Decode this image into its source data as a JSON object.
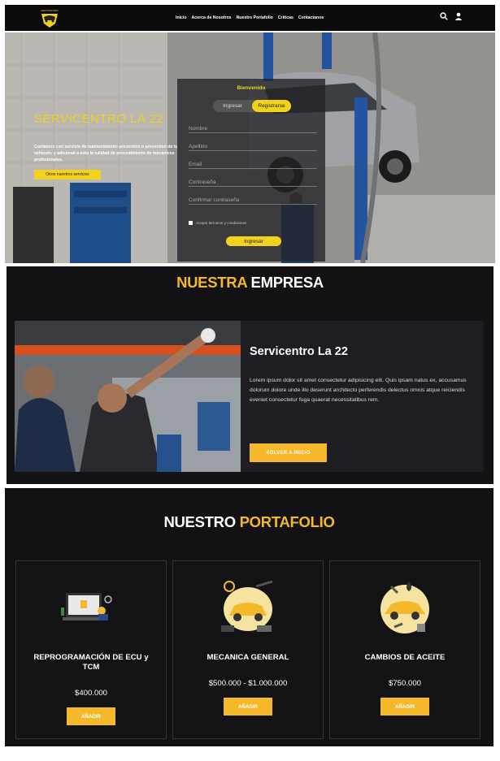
{
  "nav": {
    "logo_text": "SERVICENTRO",
    "menu": [
      "Inicio",
      "Acerca de Nosotros",
      "Nuestro Portafolio",
      "Críticas",
      "Contactanos"
    ],
    "icons": [
      "search-icon",
      "user-icon"
    ]
  },
  "hero": {
    "title": "SERVICENTRO LA 22",
    "text": "Contamos con servicio de mantenimiento preventivo o preventivo de tu vehículo, y adicional a esto la calidad de procedimiento de mecánicos profesionales.",
    "button": "Otros nuestros servicios"
  },
  "login": {
    "welcome": "Bienvenido",
    "tab_login": "Ingresar",
    "tab_register": "Registrarse",
    "fields": [
      "Nombre",
      "Apellido",
      "Email",
      "Contraseña",
      "Confirmar contraseña"
    ],
    "remember": "Acepto terminos y condiciones",
    "submit": "Ingresar"
  },
  "empresa": {
    "title_a": "NUESTRA",
    "title_b": "EMPRESA",
    "name": "Servicentro La 22",
    "text": "Lorem ipsum dolor sit amet consectetur adipisicing elit. Quis ipsam natus ex, accusamus dolorum dolore unde illo deserunt architecto perferendis delectus omnis atque reiciendis eveniet consectetur fuga quaerat necessitatibus rem.",
    "button": "VOLVER A INICIO"
  },
  "portafolio": {
    "title_a": "NUESTRO",
    "title_b": "PORTAFOLIO",
    "cards": [
      {
        "name": "REPROGRAMACIÓN DE ECU y TCM",
        "price": "$400.000",
        "button": "AÑADIR",
        "icon": "laptop-ecu-icon"
      },
      {
        "name": "MECANICA GENERAL",
        "price": "$500.000 - $1.000.000",
        "button": "AÑADIR",
        "icon": "car-repair-icon"
      },
      {
        "name": "CAMBIOS DE ACEITE",
        "price": "$750.000",
        "button": "AÑADIR",
        "icon": "oil-change-icon"
      }
    ]
  },
  "colors": {
    "accent": "#f5b82a",
    "hero_accent": "#f2d21b",
    "dark": "#121214"
  }
}
